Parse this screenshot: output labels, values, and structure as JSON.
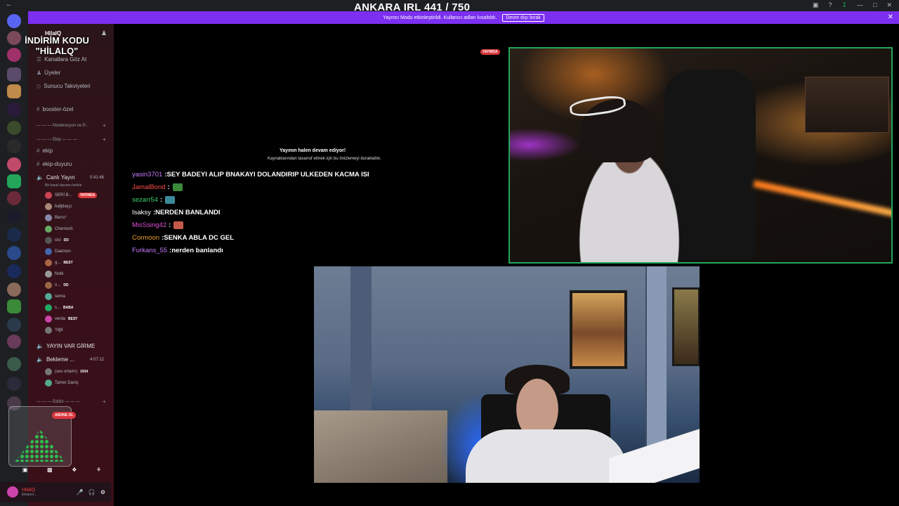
{
  "window": {
    "overlay_title": "ANKARA IRL 441 / 750"
  },
  "banner": {
    "text": "Yayıncı Modu etkinleştirildi. Kullanıcı adları kısaltıldı.",
    "disable_label": "Devre dışı bırak"
  },
  "promo": {
    "line1": "İNDİRİM KODU",
    "line2": "\"HİLALQ\""
  },
  "server": {
    "name": "HilalQ",
    "menu": [
      {
        "label": "Kanallara Göz At"
      },
      {
        "label": "Üyeler"
      },
      {
        "label": "Sunucu Takviyeleri"
      }
    ]
  },
  "channels": {
    "booster": "booster-özel",
    "cat_moderation": "Moderasyon ve P...",
    "cat_ekip": "Ekip",
    "ekip": "ekip",
    "ekip_duyuru": "ekip-duyuru",
    "voice_live": "Canlı Yayın",
    "voice_live_timer": "0:41:46",
    "voice_live_status": "Bir kanal durumu belirle",
    "voice_yayin_var": "YAYIN VAR GİRME",
    "voice_bekleme": "Bekleme ...",
    "voice_bekleme_timer": "4:07:12",
    "cat_editor": "Editör",
    "live_badge": "YAYINDA"
  },
  "voice_users": [
    {
      "name": "SERİ B...",
      "tag": ""
    },
    {
      "name": "bağdaççı",
      "tag": ""
    },
    {
      "name": "Berru°",
      "tag": ""
    },
    {
      "name": "Chemosh",
      "tag": ""
    },
    {
      "name": "cici",
      "tag": "DD"
    },
    {
      "name": "Daemon",
      "tag": ""
    },
    {
      "name": "g...",
      "tag": "BEST"
    },
    {
      "name": "Nobi",
      "tag": ""
    },
    {
      "name": "n...",
      "tag": "DD"
    },
    {
      "name": "sema",
      "tag": ""
    },
    {
      "name": "s...",
      "tag": "BABA"
    },
    {
      "name": "verda",
      "tag": "BEST"
    },
    {
      "name": "Yiğit",
      "tag": ""
    }
  ],
  "waiting_users": [
    {
      "name": "(ses ortamı)",
      "tag": "1934"
    },
    {
      "name": "Tamer Daniş",
      "tag": ""
    }
  ],
  "subscribe_pill": "ABONE OL",
  "userbar": {
    "name": "HilalQ",
    "status": "Ekranın..."
  },
  "stream": {
    "live_tag": "YAYINDA",
    "paused_title": "Yayının halen devam ediyor!",
    "paused_sub": "Kaynaklarından tasarruf etmek için bu önizlemeyi duraklattık."
  },
  "chat": [
    {
      "user": "yasin3701",
      "color": "#c97bff",
      "text": "SEY BADEYI ALIP BNAKAYI DOLANDIRIP ULKEDEN KACMA ISI",
      "emote": ""
    },
    {
      "user": "JamalBond",
      "color": "#ff4d4d",
      "text": "",
      "emote": "#3a8a3a"
    },
    {
      "user": "sezarr54",
      "color": "#3ad16b",
      "text": "",
      "emote": "#3a8a9a"
    },
    {
      "user": "Isaksy",
      "color": "#ffffff",
      "text": "NERDEN BANLANDI",
      "emote": ""
    },
    {
      "user": "MisSsing42",
      "color": "#e04fd6",
      "text": "",
      "emote": "#c45a4a"
    },
    {
      "user": "Cormoon",
      "color": "#f0a030",
      "text": "SENKA ABLA DC GEL",
      "emote": ""
    },
    {
      "user": "Furkans_55",
      "color": "#c97bff",
      "text": "nerden banlandı",
      "emote": ""
    }
  ]
}
